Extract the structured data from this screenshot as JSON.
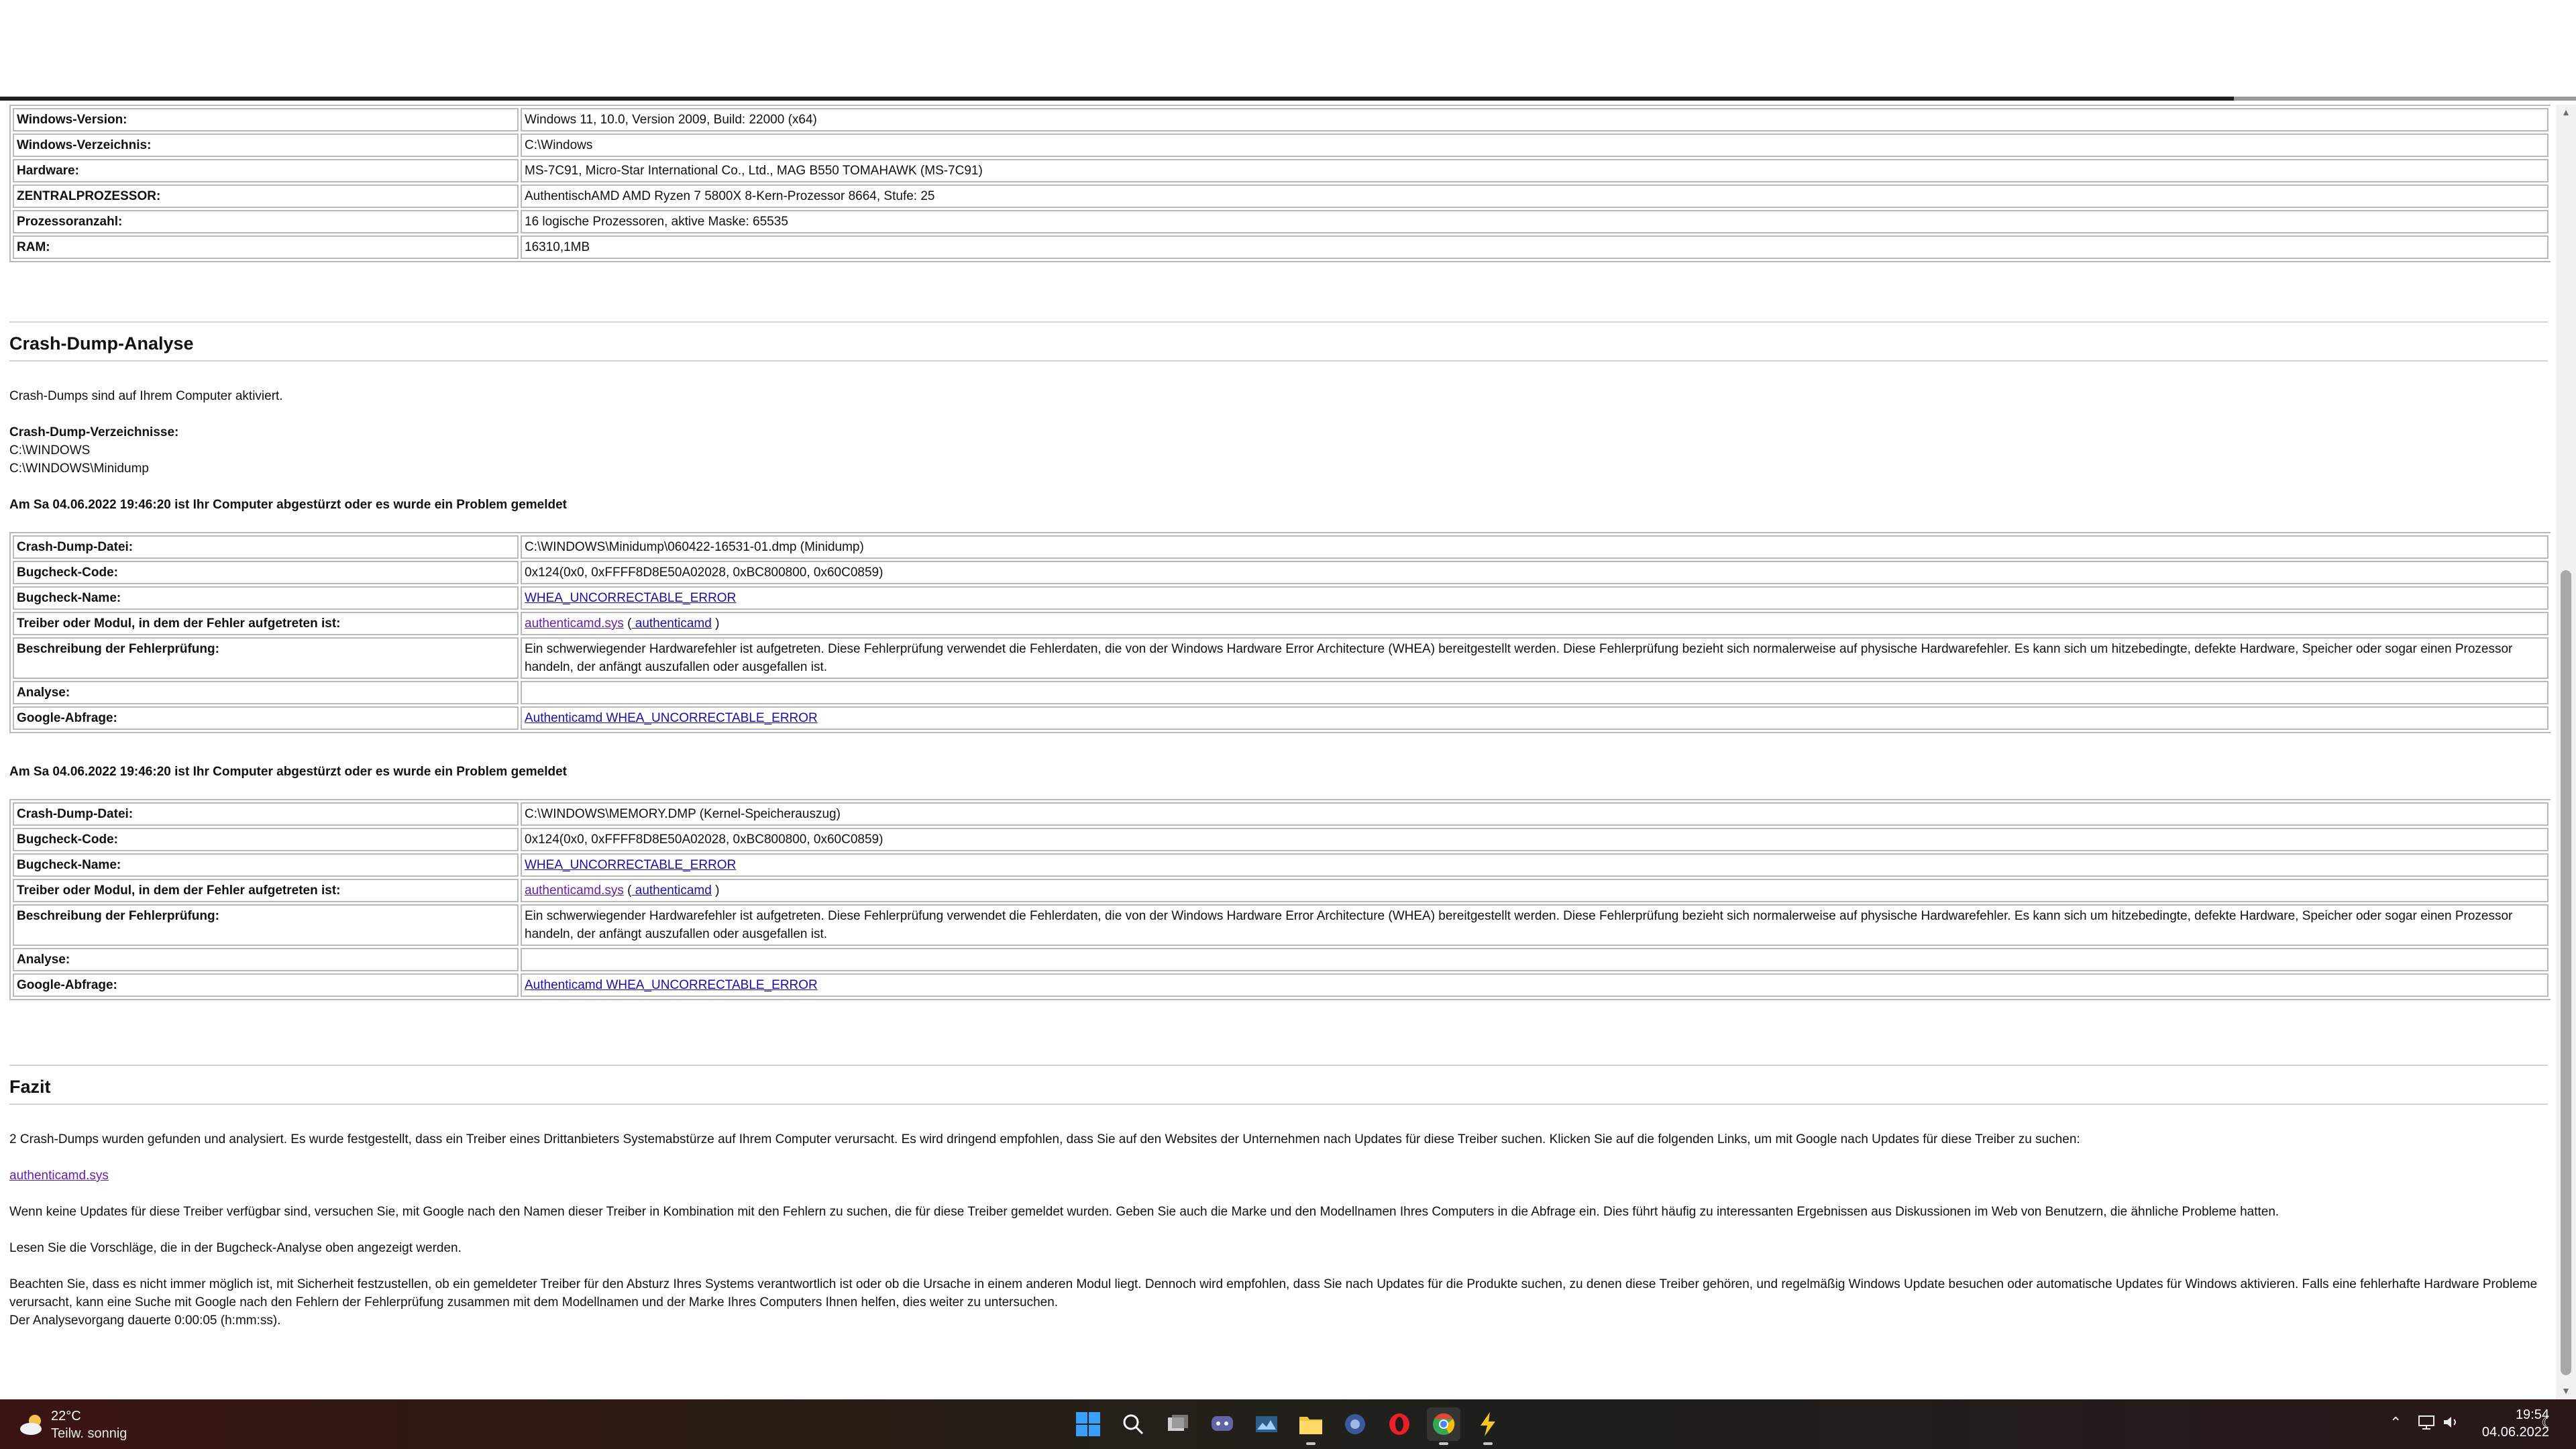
{
  "system_table": [
    {
      "key": "Windows-Version:",
      "value": "Windows 11, 10.0, Version 2009, Build: 22000 (x64)"
    },
    {
      "key": "Windows-Verzeichnis:",
      "value": "C:\\Windows"
    },
    {
      "key": "Hardware:",
      "value": "MS-7C91, Micro-Star International Co., Ltd., MAG B550 TOMAHAWK (MS-7C91)"
    },
    {
      "key": "ZENTRALPROZESSOR:",
      "value": "AuthentischAMD AMD Ryzen 7 5800X 8-Kern-Prozessor 8664, Stufe: 25"
    },
    {
      "key": "Prozessoranzahl:",
      "value": "16 logische Prozessoren, aktive Maske: 65535"
    },
    {
      "key": "RAM:",
      "value": "16310,1MB"
    }
  ],
  "crash_section": {
    "title": "Crash-Dump-Analyse",
    "enabled_text": "Crash-Dumps sind auf Ihrem Computer aktiviert.",
    "dirs_label": "Crash-Dump-Verzeichnisse:",
    "dirs": [
      "C:\\WINDOWS",
      "C:\\WINDOWS\\Minidump"
    ]
  },
  "dumps": [
    {
      "heading": "Am Sa 04.06.2022 19:46:20 ist Ihr Computer abgestürzt oder es wurde ein Problem gemeldet",
      "labels": {
        "file": "Crash-Dump-Datei:",
        "code": "Bugcheck-Code:",
        "name": "Bugcheck-Name:",
        "driver": "Treiber oder Modul, in dem der Fehler aufgetreten ist:",
        "desc": "Beschreibung der Fehlerprüfung:",
        "analysis": "Analyse:",
        "google": "Google-Abfrage:"
      },
      "file": "C:\\WINDOWS\\Minidump\\060422-16531-01.dmp (Minidump)",
      "code": "0x124(0x0, 0xFFFF8D8E50A02028, 0xBC800800, 0x60C0859)",
      "name": "WHEA_UNCORRECTABLE_ERROR",
      "driver_link": "authenticamd.sys",
      "driver_open": " (",
      "driver_module": " authenticamd",
      "driver_close": " )",
      "desc": "Ein schwerwiegender Hardwarefehler ist aufgetreten. Diese Fehlerprüfung verwendet die Fehlerdaten, die von der Windows Hardware Error Architecture (WHEA) bereitgestellt werden. Diese Fehlerprüfung bezieht sich normalerweise auf physische Hardwarefehler. Es kann sich um hitzebedingte, defekte Hardware, Speicher oder sogar einen Prozessor handeln, der anfängt auszufallen oder ausgefallen ist.",
      "analysis": "",
      "google": "Authenticamd WHEA_UNCORRECTABLE_ERROR"
    },
    {
      "heading": "Am Sa 04.06.2022 19:46:20 ist Ihr Computer abgestürzt oder es wurde ein Problem gemeldet",
      "labels": {
        "file": "Crash-Dump-Datei:",
        "code": "Bugcheck-Code:",
        "name": "Bugcheck-Name:",
        "driver": "Treiber oder Modul, in dem der Fehler aufgetreten ist:",
        "desc": "Beschreibung der Fehlerprüfung:",
        "analysis": "Analyse:",
        "google": "Google-Abfrage:"
      },
      "file": "C:\\WINDOWS\\MEMORY.DMP (Kernel-Speicherauszug)",
      "code": "0x124(0x0, 0xFFFF8D8E50A02028, 0xBC800800, 0x60C0859)",
      "name": "WHEA_UNCORRECTABLE_ERROR",
      "driver_link": "authenticamd.sys",
      "driver_open": " (",
      "driver_module": " authenticamd",
      "driver_close": " )",
      "desc": "Ein schwerwiegender Hardwarefehler ist aufgetreten. Diese Fehlerprüfung verwendet die Fehlerdaten, die von der Windows Hardware Error Architecture (WHEA) bereitgestellt werden. Diese Fehlerprüfung bezieht sich normalerweise auf physische Hardwarefehler. Es kann sich um hitzebedingte, defekte Hardware, Speicher oder sogar einen Prozessor handeln, der anfängt auszufallen oder ausgefallen ist.",
      "analysis": "",
      "google": "Authenticamd WHEA_UNCORRECTABLE_ERROR"
    }
  ],
  "conclusion": {
    "title": "Fazit",
    "p1": "2 Crash-Dumps wurden gefunden und analysiert. Es wurde festgestellt, dass ein Treiber eines Drittanbieters Systemabstürze auf Ihrem Computer verursacht. Es wird dringend empfohlen, dass Sie auf den Websites der Unternehmen nach Updates für diese Treiber suchen. Klicken Sie auf die folgenden Links, um mit Google nach Updates für diese Treiber zu suchen:",
    "driver_link": "authenticamd.sys",
    "p2": "Wenn keine Updates für diese Treiber verfügbar sind, versuchen Sie, mit Google nach den Namen dieser Treiber in Kombination mit den Fehlern zu suchen, die für diese Treiber gemeldet wurden. Geben Sie auch die Marke und den Modellnamen Ihres Computers in die Abfrage ein. Dies führt häufig zu interessanten Ergebnissen aus Diskussionen im Web von Benutzern, die ähnliche Probleme hatten.",
    "p3": "Lesen Sie die Vorschläge, die in der Bugcheck-Analyse oben angezeigt werden.",
    "p4": "Beachten Sie, dass es nicht immer möglich ist, mit Sicherheit festzustellen, ob ein gemeldeter Treiber für den Absturz Ihres Systems verantwortlich ist oder ob die Ursache in einem anderen Modul liegt. Dennoch wird empfohlen, dass Sie nach Updates für die Produkte suchen, zu denen diese Treiber gehören, und regelmäßig Windows Update besuchen oder automatische Updates für Windows aktivieren. Falls eine fehlerhafte Hardware Probleme verursacht, kann eine Suche mit Google nach den Fehlern der Fehlerprüfung zusammen mit dem Modellnamen und der Marke Ihres Computers Ihnen helfen, dies weiter zu untersuchen.",
    "p5": "Der Analysevorgang dauerte 0:00:05 (h:mm:ss)."
  },
  "taskbar": {
    "weather_temp": "22°C",
    "weather_desc": "Teilw. sonnig",
    "time": "19:54",
    "date": "04.06.2022",
    "icons": [
      "windows-start-icon",
      "search-icon",
      "task-view-icon",
      "chat-icon",
      "widgets-icon",
      "file-explorer-icon",
      "app-icon",
      "opera-icon",
      "chrome-icon",
      "winamp-icon"
    ],
    "colors": {
      "folder": "#f5c23b",
      "opera": "#e8202a",
      "start": "#2d8cf0"
    }
  }
}
